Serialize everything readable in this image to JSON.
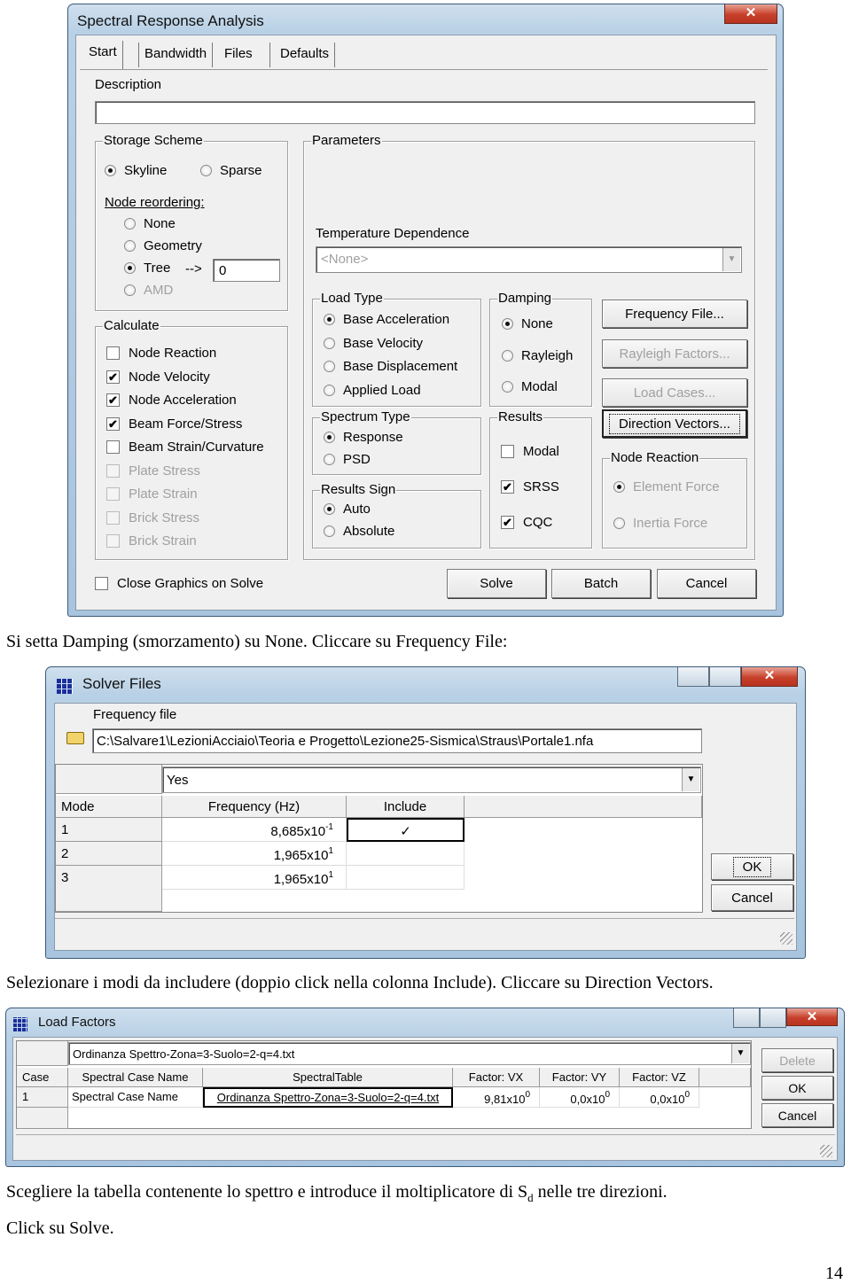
{
  "dialog1": {
    "title": "Spectral Response Analysis",
    "close_icon": "close-x-icon",
    "tabs": [
      "Start",
      "Bandwidth",
      "Files",
      "Defaults"
    ],
    "active_tab": "Start",
    "description_label": "Description",
    "description_value": "",
    "storage_scheme": {
      "legend": "Storage Scheme",
      "options": [
        {
          "label": "Skyline",
          "selected": true
        },
        {
          "label": "Sparse",
          "selected": false
        }
      ],
      "node_reordering_label": "Node reordering:",
      "reorder_options": [
        {
          "label": "None",
          "selected": false,
          "disabled": false
        },
        {
          "label": "Geometry",
          "selected": false,
          "disabled": false
        },
        {
          "label": "Tree",
          "selected": true,
          "disabled": false
        },
        {
          "label": "AMD",
          "selected": false,
          "disabled": true
        }
      ],
      "tree_arrow": "-->",
      "tree_value": "0"
    },
    "calculate": {
      "legend": "Calculate",
      "items": [
        {
          "label": "Node Reaction",
          "checked": false,
          "disabled": false
        },
        {
          "label": "Node Velocity",
          "checked": true,
          "disabled": false
        },
        {
          "label": "Node Acceleration",
          "checked": true,
          "disabled": false
        },
        {
          "label": "Beam Force/Stress",
          "checked": true,
          "disabled": false
        },
        {
          "label": "Beam Strain/Curvature",
          "checked": false,
          "disabled": false
        },
        {
          "label": "Plate Stress",
          "checked": false,
          "disabled": true
        },
        {
          "label": "Plate Strain",
          "checked": false,
          "disabled": true
        },
        {
          "label": "Brick Stress",
          "checked": false,
          "disabled": true
        },
        {
          "label": "Brick Strain",
          "checked": false,
          "disabled": true
        }
      ]
    },
    "parameters": {
      "legend": "Parameters",
      "temp_label": "Temperature Dependence",
      "temp_value": "<None>",
      "load_type": {
        "legend": "Load Type",
        "options": [
          {
            "label": "Base Acceleration",
            "selected": true
          },
          {
            "label": "Base Velocity",
            "selected": false
          },
          {
            "label": "Base Displacement",
            "selected": false
          },
          {
            "label": "Applied Load",
            "selected": false
          }
        ]
      },
      "damping": {
        "legend": "Damping",
        "options": [
          {
            "label": "None",
            "selected": true
          },
          {
            "label": "Rayleigh",
            "selected": false
          },
          {
            "label": "Modal",
            "selected": false
          }
        ]
      },
      "spectrum_type": {
        "legend": "Spectrum Type",
        "options": [
          {
            "label": "Response",
            "selected": true
          },
          {
            "label": "PSD",
            "selected": false
          }
        ]
      },
      "results": {
        "legend": "Results",
        "items": [
          {
            "label": "Modal",
            "checked": false
          },
          {
            "label": "SRSS",
            "checked": true
          },
          {
            "label": "CQC",
            "checked": true
          }
        ]
      },
      "results_sign": {
        "legend": "Results Sign",
        "options": [
          {
            "label": "Auto",
            "selected": true
          },
          {
            "label": "Absolute",
            "selected": false
          }
        ]
      },
      "buttons": [
        {
          "label": "Frequency File...",
          "disabled": false,
          "focused": false
        },
        {
          "label": "Rayleigh Factors...",
          "disabled": true,
          "focused": false
        },
        {
          "label": "Load Cases...",
          "disabled": true,
          "focused": false
        },
        {
          "label": "Direction Vectors...",
          "disabled": false,
          "focused": true
        }
      ],
      "node_reaction": {
        "legend": "Node Reaction",
        "options": [
          {
            "label": "Element Force",
            "selected": true
          },
          {
            "label": "Inertia Force",
            "selected": false
          }
        ]
      }
    },
    "close_graphics": {
      "label": "Close Graphics on Solve",
      "checked": false
    },
    "footer_buttons": [
      "Solve",
      "Batch",
      "Cancel"
    ]
  },
  "caption1": "Si setta Damping (smorzamento) su None. Cliccare su Frequency File:",
  "dialog2": {
    "title": "Solver Files",
    "freq_label": "Frequency file",
    "freq_path": "C:\\Salvare1\\LezioniAcciaio\\Teoria e Progetto\\Lezione25-Sismica\\Straus\\Portale1.nfa",
    "editor_value": "Yes",
    "columns": [
      "Mode",
      "Frequency (Hz)",
      "Include"
    ],
    "rows": [
      {
        "mode": "1",
        "mantissa": "8,685x10",
        "exp": "-1",
        "include": "✓"
      },
      {
        "mode": "2",
        "mantissa": "1,965x10",
        "exp": "1",
        "include": ""
      },
      {
        "mode": "3",
        "mantissa": "1,965x10",
        "exp": "1",
        "include": ""
      }
    ],
    "ok": "OK",
    "cancel": "Cancel"
  },
  "caption2": "Selezionare i modi da includere (doppio click nella colonna Include). Cliccare su Direction Vectors.",
  "dialog3": {
    "title": "Load Factors",
    "editor_value": "Ordinanza Spettro-Zona=3-Suolo=2-q=4.txt",
    "columns": [
      "Case",
      "Spectral Case Name",
      "SpectralTable",
      "Factor: VX",
      "Factor: VY",
      "Factor: VZ"
    ],
    "rows": [
      {
        "case": "1",
        "name": "Spectral Case Name",
        "table": "Ordinanza Spettro-Zona=3-Suolo=2-q=4.txt",
        "vx_m": "9,81x10",
        "vx_e": "0",
        "vy_m": "0,0x10",
        "vy_e": "0",
        "vz_m": "0,0x10",
        "vz_e": "0"
      }
    ],
    "delete": "Delete",
    "ok": "OK",
    "cancel": "Cancel"
  },
  "caption3_a": "Scegliere la tabella contenente lo spettro e introduce il moltiplicatore di S",
  "caption3_sub": "d",
  "caption3_b": " nelle tre direzioni.",
  "caption4": "Click su Solve.",
  "page_number": "14"
}
